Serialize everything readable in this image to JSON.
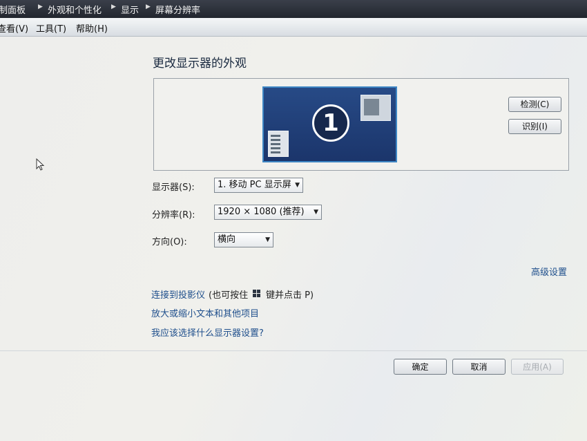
{
  "breadcrumb": {
    "items": [
      "制面板",
      "外观和个性化",
      "显示",
      "屏幕分辨率"
    ]
  },
  "menubar": {
    "items": [
      "查看(V)",
      "工具(T)",
      "帮助(H)"
    ]
  },
  "main": {
    "title": "更改显示器的外观",
    "monitor_number": "1",
    "detect_button": "检测(C)",
    "identify_button": "识别(I)",
    "display_label": "显示器(S):",
    "display_value": "1. 移动 PC 显示屏",
    "resolution_label": "分辨率(R):",
    "resolution_value": "1920 × 1080 (推荐)",
    "orientation_label": "方向(O):",
    "orientation_value": "横向",
    "advanced_link": "高级设置",
    "projector_link": "连接到投影仪",
    "projector_hint_prefix": "(也可按住",
    "projector_hint_suffix": "键并点击 P)",
    "text_size_link": "放大或缩小文本和其他项目",
    "which_settings_link": "我应该选择什么显示器设置?"
  },
  "footer": {
    "ok_button": "确定",
    "cancel_button": "取消",
    "apply_button": "应用(A)"
  },
  "icons": {
    "breadcrumb_separator": "triangle-right-icon",
    "dropdown": "chevron-down-icon",
    "windows_key": "windows-logo-icon",
    "cursor": "mouse-pointer-icon"
  },
  "colors": {
    "monitor_fill": "#274a86",
    "monitor_border": "#3d86c4",
    "link": "#1f4f8c"
  }
}
